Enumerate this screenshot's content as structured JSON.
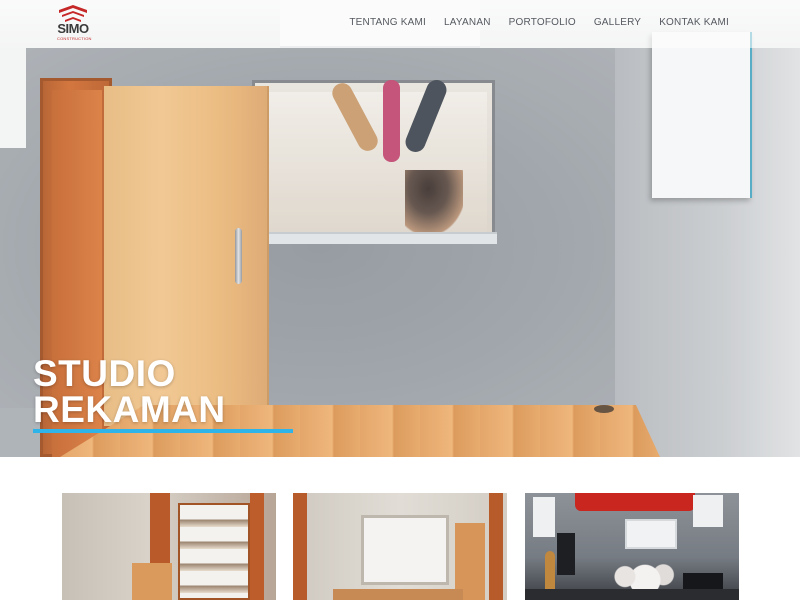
{
  "brand": {
    "name": "SIMO",
    "tagline": "CONSTRUCTION",
    "logo_color": "#c62828"
  },
  "nav": {
    "items": [
      {
        "label": "TENTANG KAMI"
      },
      {
        "label": "LAYANAN"
      },
      {
        "label": "PORTOFOLIO"
      },
      {
        "label": "GALLERY"
      },
      {
        "label": "KONTAK KAMI"
      }
    ]
  },
  "hero": {
    "title_line1": "STUDIO",
    "title_line2": "REKAMAN",
    "accent_color": "#2fb4ea"
  },
  "gallery": {
    "thumbnails": [
      {
        "subject": "cabinet-construction-photo"
      },
      {
        "subject": "room-interior-photo"
      },
      {
        "subject": "music-studio-photo"
      }
    ]
  }
}
